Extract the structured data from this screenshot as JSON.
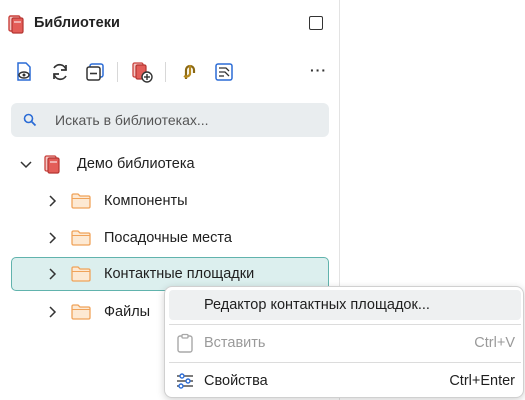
{
  "header": {
    "title": "Библиотеки",
    "icon": "library-books-icon",
    "maximize_icon": "maximize-icon"
  },
  "toolbar": {
    "buttons": [
      {
        "name": "view-library-button",
        "icon": "document-eye-icon"
      },
      {
        "name": "refresh-button",
        "icon": "refresh-icon"
      },
      {
        "name": "collapse-all-button",
        "icon": "collapse-all-icon"
      },
      {
        "name": "add-library-button",
        "icon": "library-add-icon"
      },
      {
        "name": "link-button",
        "icon": "chain-link-icon"
      },
      {
        "name": "component-view-button",
        "icon": "component-image-icon"
      }
    ],
    "more_label": "···"
  },
  "search": {
    "placeholder": "Искать в библиотеках..."
  },
  "tree": {
    "root": {
      "label": "Демо библиотека",
      "expanded": true
    },
    "items": [
      {
        "label": "Компоненты",
        "selected": false
      },
      {
        "label": "Посадочные места",
        "selected": false
      },
      {
        "label": "Контактные площадки",
        "selected": true
      },
      {
        "label": "Файлы",
        "selected": false
      }
    ]
  },
  "context_menu": {
    "items": [
      {
        "label": "Редактор контактных площадок...",
        "shortcut": "",
        "enabled": true,
        "icon": ""
      },
      {
        "label": "Вставить",
        "shortcut": "Ctrl+V",
        "enabled": false,
        "icon": "clipboard-icon"
      },
      {
        "label": "Свойства",
        "shortcut": "Ctrl+Enter",
        "enabled": true,
        "icon": "sliders-icon"
      }
    ]
  },
  "colors": {
    "accent": "#2b6cd6",
    "library_red": "#d9534f",
    "folder_orange": "#f0a35a",
    "selection_bg": "#dcefee",
    "selection_border": "#61b3ad"
  }
}
